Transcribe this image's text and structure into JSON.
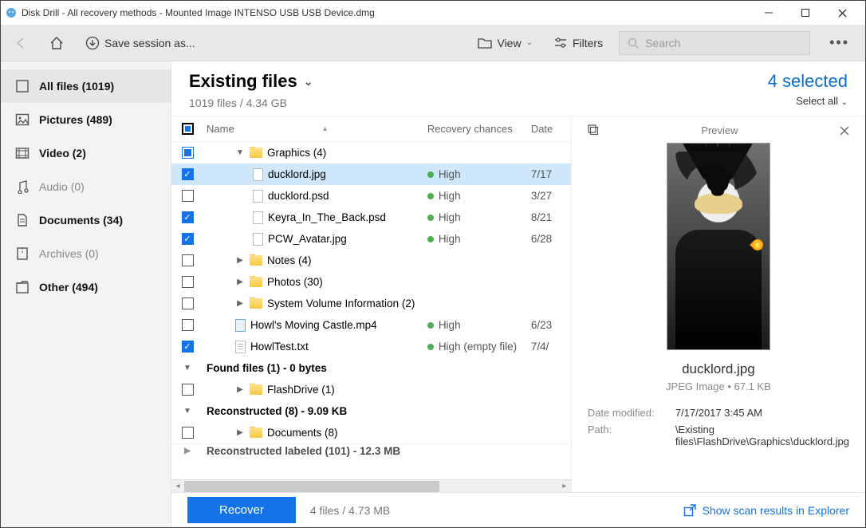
{
  "window": {
    "title": "Disk Drill - All recovery methods - Mounted Image INTENSO USB USB Device.dmg"
  },
  "toolbar": {
    "save_session": "Save session as...",
    "view": "View",
    "filters": "Filters",
    "search_placeholder": "Search"
  },
  "sidebar": {
    "items": [
      {
        "label": "All files (1019)",
        "bold": true,
        "active": true,
        "icon": "files"
      },
      {
        "label": "Pictures (489)",
        "bold": true,
        "icon": "picture"
      },
      {
        "label": "Video (2)",
        "bold": true,
        "icon": "video"
      },
      {
        "label": "Audio (0)",
        "bold": false,
        "icon": "audio"
      },
      {
        "label": "Documents (34)",
        "bold": true,
        "icon": "document"
      },
      {
        "label": "Archives (0)",
        "bold": false,
        "icon": "archive"
      },
      {
        "label": "Other (494)",
        "bold": true,
        "icon": "other"
      }
    ]
  },
  "header": {
    "title": "Existing files",
    "subtitle": "1019 files / 4.34 GB",
    "selected": "4 selected",
    "select_all": "Select all"
  },
  "columns": {
    "name": "Name",
    "recovery": "Recovery chances",
    "date": "Date"
  },
  "rows": [
    {
      "type": "folder",
      "indent": 1,
      "expand": "down",
      "name": "Graphics (4)",
      "check": "partial"
    },
    {
      "type": "file",
      "indent": 2,
      "name": "ducklord.jpg",
      "check": "checked",
      "selected": true,
      "recovery": "High",
      "date": "7/17"
    },
    {
      "type": "file",
      "indent": 2,
      "name": "ducklord.psd",
      "check": "",
      "recovery": "High",
      "date": "3/27"
    },
    {
      "type": "file",
      "indent": 2,
      "name": "Keyra_In_The_Back.psd",
      "check": "checked",
      "recovery": "High",
      "date": "8/21"
    },
    {
      "type": "file",
      "indent": 2,
      "name": "PCW_Avatar.jpg",
      "check": "checked",
      "recovery": "High",
      "date": "6/28"
    },
    {
      "type": "folder",
      "indent": 1,
      "expand": "right",
      "name": "Notes (4)",
      "check": ""
    },
    {
      "type": "folder",
      "indent": 1,
      "expand": "right",
      "name": "Photos (30)",
      "check": ""
    },
    {
      "type": "folder",
      "indent": 1,
      "expand": "right",
      "name": "System Volume Information (2)",
      "check": ""
    },
    {
      "type": "file",
      "indent": 1,
      "icon": "video",
      "name": "Howl's Moving Castle.mp4",
      "check": "",
      "recovery": "High",
      "date": "6/23"
    },
    {
      "type": "file",
      "indent": 1,
      "icon": "text",
      "name": "HowlTest.txt",
      "check": "checked",
      "recovery": "High (empty file)",
      "date": "7/4/"
    },
    {
      "type": "groupheader",
      "name": "Found files (1) - 0 bytes",
      "expand": "down"
    },
    {
      "type": "folder",
      "indent": 1,
      "expand": "right",
      "name": "FlashDrive (1)",
      "check": ""
    },
    {
      "type": "groupheader",
      "name": "Reconstructed (8) - 9.09 KB",
      "expand": "down"
    },
    {
      "type": "folder",
      "indent": 1,
      "expand": "right",
      "name": "Documents (8)",
      "check": ""
    },
    {
      "type": "groupheader",
      "name": "Reconstructed labeled (101) - 12.3 MB",
      "expand": "right",
      "cut": true
    }
  ],
  "preview": {
    "title": "Preview",
    "filename": "ducklord.jpg",
    "meta": "JPEG Image • 67.1 KB",
    "date_label": "Date modified:",
    "date_value": "7/17/2017 3:45 AM",
    "path_label": "Path:",
    "path_value": "\\Existing files\\FlashDrive\\Graphics\\ducklord.jpg"
  },
  "footer": {
    "recover": "Recover",
    "info": "4 files / 4.73 MB",
    "explorer": "Show scan results in Explorer"
  }
}
